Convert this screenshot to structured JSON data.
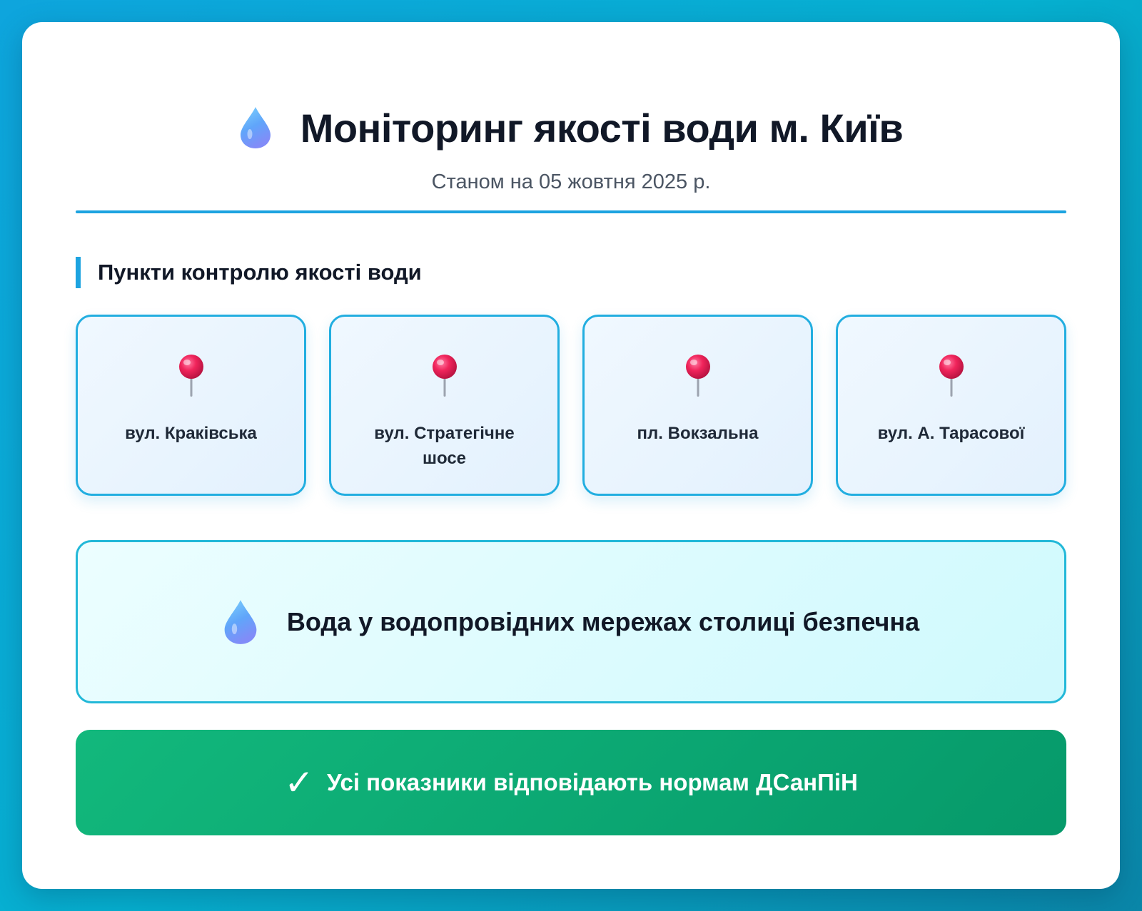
{
  "header": {
    "icon": "water-drop-icon",
    "title": "Моніторинг якості води м. Київ",
    "subtitle": "Станом на 05 жовтня 2025 р."
  },
  "section": {
    "title": "Пункти контролю якості води"
  },
  "points": [
    {
      "icon": "pushpin-icon",
      "label": "вул. Краківська"
    },
    {
      "icon": "pushpin-icon",
      "label": "вул. Стратегічне шосе"
    },
    {
      "icon": "pushpin-icon",
      "label": "пл. Вокзальна"
    },
    {
      "icon": "pushpin-icon",
      "label": "вул. А. Тарасової"
    }
  ],
  "safe_notice": {
    "icon": "water-drop-icon",
    "text": "Вода у водопровідних мережах столиці безпечна"
  },
  "compliance": {
    "icon": "checkmark-icon",
    "check_glyph": "✓",
    "text": "Усі показники відповідають нормам ДСанПіН"
  },
  "colors": {
    "accent": "#1ca3e0",
    "success": "#0ea673",
    "pin": "#e11d48"
  }
}
